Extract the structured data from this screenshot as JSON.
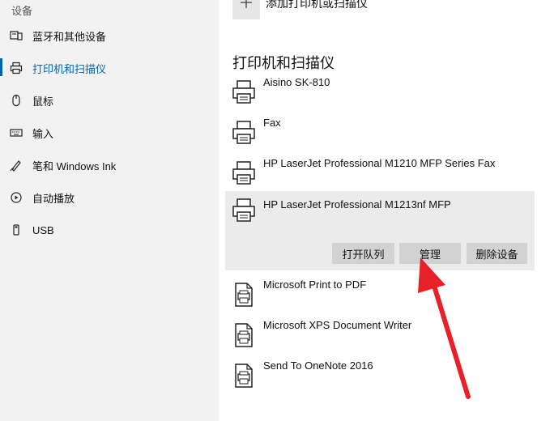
{
  "sidebar": {
    "section_title": "设备",
    "items": [
      {
        "label": "蓝牙和其他设备",
        "icon": "bluetooth-device-icon"
      },
      {
        "label": "打印机和扫描仪",
        "icon": "printer-icon"
      },
      {
        "label": "鼠标",
        "icon": "mouse-icon"
      },
      {
        "label": "输入",
        "icon": "keyboard-icon"
      },
      {
        "label": "笔和 Windows Ink",
        "icon": "pen-icon"
      },
      {
        "label": "自动播放",
        "icon": "autoplay-icon"
      },
      {
        "label": "USB",
        "icon": "usb-icon"
      }
    ],
    "active_index": 1
  },
  "main": {
    "add_label": "添加打印机或扫描仪",
    "add_icon": "plus-icon",
    "heading": "打印机和扫描仪",
    "devices": [
      {
        "name": "Aisino SK-810",
        "icon": "printer-icon"
      },
      {
        "name": "Fax",
        "icon": "printer-icon"
      },
      {
        "name": "HP LaserJet Professional M1210 MFP Series Fax",
        "icon": "printer-icon"
      },
      {
        "name": "HP LaserJet Professional M1213nf MFP",
        "icon": "printer-icon",
        "selected": true
      },
      {
        "name": "Microsoft Print to PDF",
        "icon": "document-printer-icon"
      },
      {
        "name": "Microsoft XPS Document Writer",
        "icon": "document-printer-icon"
      },
      {
        "name": "Send To OneNote 2016",
        "icon": "document-printer-icon"
      }
    ],
    "actions": {
      "open_queue": "打开队列",
      "manage": "管理",
      "remove": "删除设备"
    }
  },
  "colors": {
    "accent": "#0063b1",
    "sidebar_bg": "#f2f2f2",
    "selected_bg": "#ebebeb",
    "button_bg": "#d2d2d2",
    "annotation_arrow": "#e8202a"
  }
}
